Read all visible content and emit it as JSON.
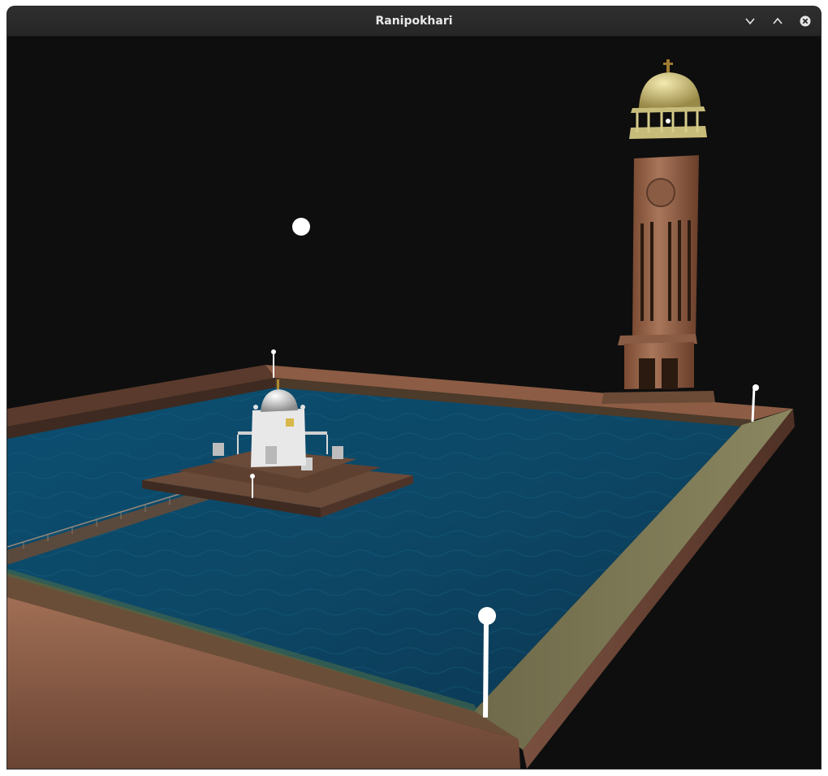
{
  "window": {
    "title": "Ranipokhari",
    "controls": {
      "minimize_icon": "chevron-down-icon",
      "maximize_icon": "chevron-up-icon",
      "close_icon": "close-icon"
    }
  },
  "scene": {
    "background_color": "#0e0e0e",
    "water_color": "#0d4a6b",
    "wall_color": "#8a5a45",
    "tower_color": "#9a6a4e",
    "dome_color": "#c9b878",
    "temple_color": "#e6e6e6",
    "lamp_color": "#ffffff"
  }
}
